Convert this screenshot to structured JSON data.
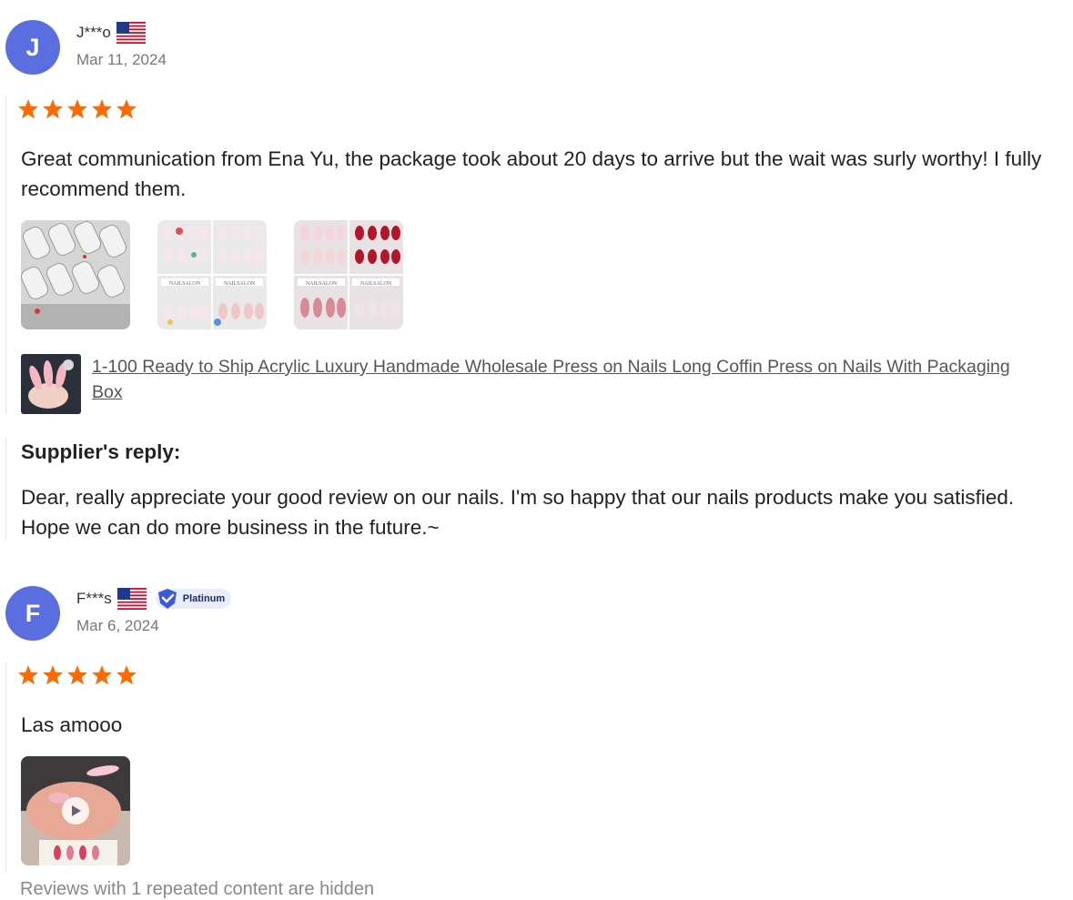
{
  "reviews": [
    {
      "avatar_letter": "J",
      "name": "J***o",
      "country": "us-flag-icon",
      "badge": null,
      "date": "Mar 11, 2024",
      "rating": 5,
      "text": "Great communication from Ena Yu, the package took about 20 days to arrive but the wait was surly worthy! I fully recommend them.",
      "images": [
        "nail-photo-1",
        "nail-photo-2",
        "nail-photo-3"
      ],
      "product_title": "1-100 Ready to Ship Acrylic Luxury Handmade Wholesale Press on Nails Long Coffin Press on Nails With Packaging Box",
      "supplier_reply": {
        "title": "Supplier's reply:",
        "text": "Dear, really appreciate your good review on our nails. I'm so happy that our nails products make you satisfied. Hope we can do more business in the future.~"
      }
    },
    {
      "avatar_letter": "F",
      "name": "F***s",
      "country": "us-flag-icon",
      "badge": "Platinum",
      "date": "Mar 6, 2024",
      "rating": 5,
      "text": "Las amooo",
      "video": "nail-video-thumbnail"
    }
  ],
  "footer_note": "Reviews with 1 repeated content are hidden",
  "colors": {
    "avatar": "#5b6ee0",
    "star": "#ff6a00",
    "badge_check": "#3a5bd9"
  }
}
